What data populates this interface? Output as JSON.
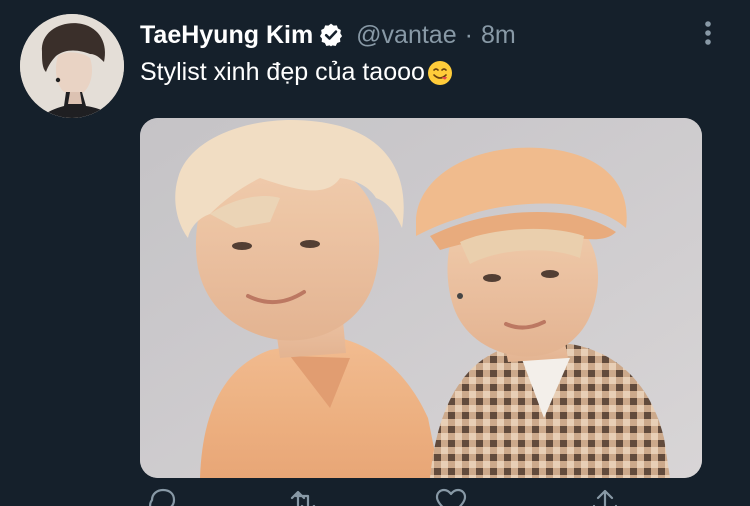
{
  "tweet": {
    "author": {
      "display_name": "TaeHyung Kim",
      "handle": "@vantae",
      "verified": true
    },
    "separator": "·",
    "time": "8m",
    "text": "Stylist xinh đẹp của taooo",
    "emoji": "yum-face",
    "media": {
      "description_icon": "photo"
    }
  },
  "icons": {
    "verified": "verified-badge-icon",
    "more": "more-vertical-icon",
    "reply": "reply-icon",
    "retweet": "retweet-icon",
    "like": "like-icon",
    "share": "share-icon"
  },
  "colors": {
    "background": "#15202b",
    "secondary_text": "#8899a6",
    "primary_text": "#ffffff"
  }
}
